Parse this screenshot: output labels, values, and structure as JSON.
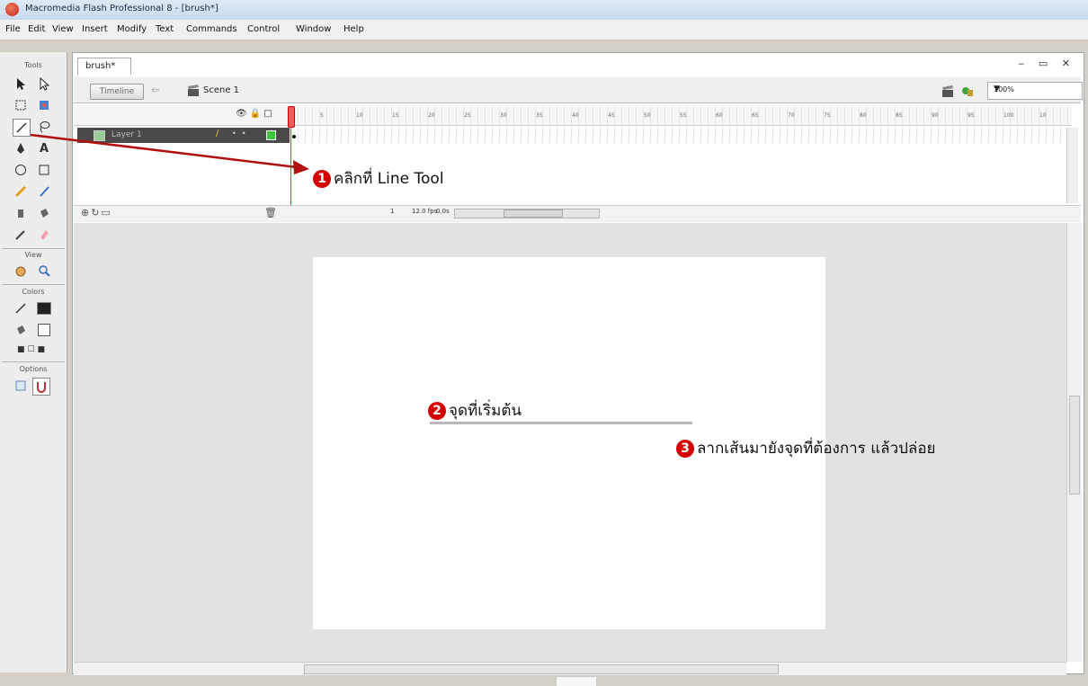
{
  "window": {
    "title": "Macromedia Flash Professional 8 - [brush*]"
  },
  "menu": {
    "items": [
      "File",
      "Edit",
      "View",
      "Insert",
      "Modify",
      "Text",
      "Commands",
      "Control",
      "Window",
      "Help"
    ]
  },
  "tools_panel": {
    "tools_label": "Tools",
    "view_label": "View",
    "colors_label": "Colors",
    "options_label": "Options",
    "accent_colors": {
      "stroke": "#222222",
      "fill": "#ffffff"
    }
  },
  "document": {
    "tab_label": "brush*",
    "timeline_button": "Timeline",
    "scene_label": "Scene 1",
    "zoom": "100%"
  },
  "timeline": {
    "frame_numbers": [
      "5",
      "10",
      "15",
      "20",
      "25",
      "30",
      "35",
      "40",
      "45",
      "50",
      "55",
      "60",
      "65",
      "70",
      "75",
      "80",
      "85",
      "90",
      "95",
      "100",
      "10"
    ],
    "layer_name": "Layer 1",
    "current_frame": "1",
    "fps": "12.0 fps",
    "elapsed": "0.0s"
  },
  "annotations": {
    "step1": {
      "number": "1",
      "text": "คลิกที่ Line Tool"
    },
    "step2": {
      "number": "2",
      "text": "จุดที่เริ่มต้น"
    },
    "step3": {
      "number": "3",
      "text": "ลากเส้นมายังจุดที่ต้องการ แล้วปล่อย"
    },
    "color": "#d40000"
  }
}
